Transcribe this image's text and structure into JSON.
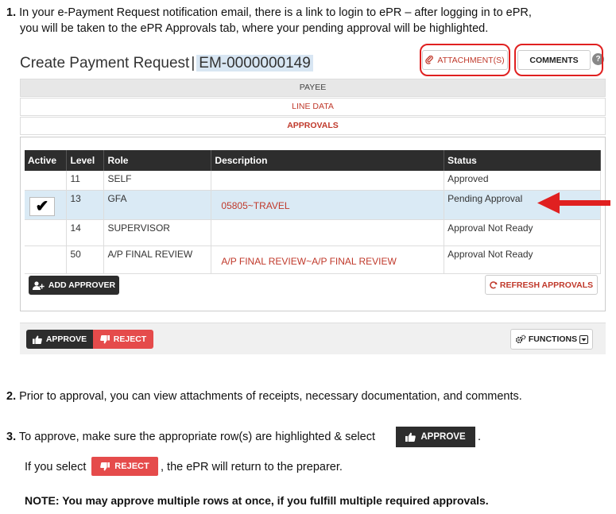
{
  "instructions": {
    "step1_num": "1.",
    "step1_line1": "In your e-Payment Request notification email, there is a link to login to ePR – after logging in to ePR,",
    "step1_line2": "you will be taken to the ePR  Approvals tab, where your pending approval will be highlighted.",
    "step2_num": "2.",
    "step2_text": "Prior to approval, you can view attachments of receipts, necessary documentation, and comments.",
    "step3_num": "3.",
    "step3_text": "To approve, make sure the appropriate row(s) are highlighted & select",
    "step3_end": ".",
    "step3b_pre": "If you select",
    "step3b_post": ", the ePR will return to the preparer.",
    "note": "NOTE:  You may approve multiple rows at once, if you fulfill multiple required approvals.",
    "approve_label": "APPROVE",
    "reject_label": "REJECT"
  },
  "screen": {
    "title": "Create Payment Request",
    "separator": "|",
    "request_id": "EM-0000000149",
    "attachments_label": "ATTACHMENT(S)",
    "comments_label": "COMMENTS",
    "help_badge": "?",
    "sections": {
      "payee": "PAYEE",
      "line_data": "LINE DATA",
      "approvals": "APPROVALS"
    },
    "table": {
      "headers": [
        "Active",
        "Level",
        "Role",
        "Description",
        "Status"
      ],
      "rows": [
        {
          "active": "",
          "level": "11",
          "role": "SELF",
          "description": "",
          "status": "Approved"
        },
        {
          "active": "✔",
          "level": "13",
          "role": "GFA",
          "description": "05805~TRAVEL",
          "status": "Pending Approval"
        },
        {
          "active": "",
          "level": "14",
          "role": "SUPERVISOR",
          "description": "",
          "status": "Approval Not Ready"
        },
        {
          "active": "",
          "level": "50",
          "role": "A/P FINAL REVIEW",
          "description": "A/P FINAL REVIEW~A/P FINAL REVIEW",
          "status": "Approval Not Ready"
        }
      ]
    },
    "add_approver_label": "ADD APPROVER",
    "refresh_label": "REFRESH APPROVALS",
    "approve_label": "APPROVE",
    "reject_label": "REJECT",
    "functions_label": "FUNCTIONS"
  },
  "colors": {
    "accent_red": "#c0392b",
    "highlight_red": "#e02020",
    "dark_button": "#2d2d2d",
    "reject_button": "#e54b4b",
    "selected_row": "#daeaf5"
  }
}
